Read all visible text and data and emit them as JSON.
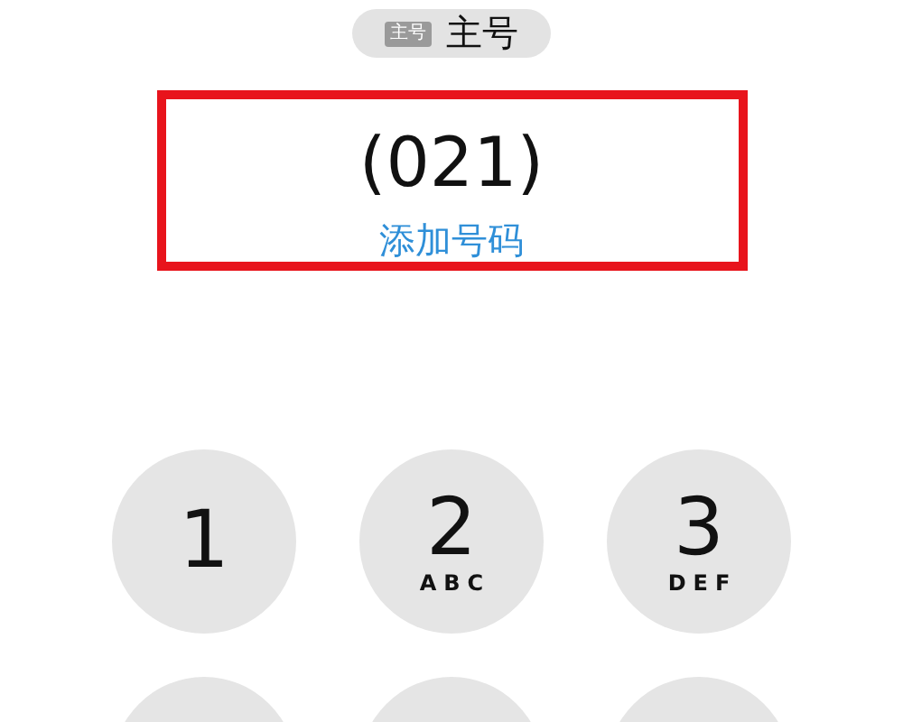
{
  "line_selector": {
    "sim_tag": "主号",
    "label": "主号"
  },
  "number_display": {
    "number": "(021)",
    "add_number_link": "添加号码"
  },
  "keypad": [
    {
      "kind": "key",
      "digit": "1"
    },
    {
      "kind": "key",
      "digit": "2",
      "letters": "ABC"
    },
    {
      "kind": "key",
      "digit": "3",
      "letters": "DEF"
    },
    {
      "kind": "cut-off"
    },
    {
      "kind": "cut-off"
    },
    {
      "kind": "cut-off"
    }
  ]
}
